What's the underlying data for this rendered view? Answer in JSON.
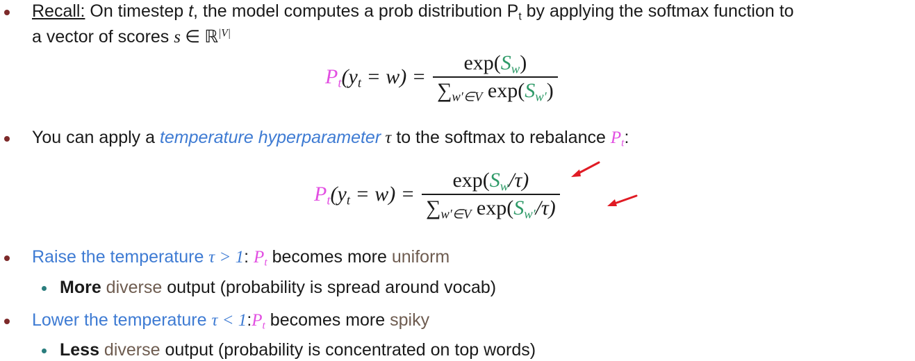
{
  "bullets": {
    "recall": {
      "label": "Recall:",
      "text_a": " On timestep ",
      "t": "t",
      "text_b": ", the model computes a prob distribution P",
      "P_sub": "t",
      "text_c": " by applying the softmax function to",
      "line2_a": "a vector of scores  ",
      "s": "s",
      "in": " ∈ ℝ",
      "sup": "|V|"
    },
    "temperature": {
      "text_a": "You can apply a ",
      "highlight": "temperature hyperparameter",
      "tau": " τ",
      "text_b": " to the softmax to rebalance ",
      "P": "P",
      "P_sub": "t",
      "colon": ":"
    },
    "raise": {
      "text_a": "Raise the temperature ",
      "cond": "τ > 1",
      "colon": ": ",
      "P": "P",
      "P_sub": "t",
      "text_b": " becomes more ",
      "word": "uniform",
      "sub_bold": "More",
      "sub_colored": " diverse",
      "sub_rest": " output (probability is spread around vocab)"
    },
    "lower": {
      "text_a": "Lower the temperature ",
      "cond": "τ < 1",
      "colon": ":",
      "P": "P",
      "P_sub": "t",
      "text_b": " becomes more ",
      "word": "spiky",
      "sub_bold": "Less",
      "sub_colored": " diverse",
      "sub_rest": " output (probability is concentrated on top words)"
    }
  },
  "formula1": {
    "P": "P",
    "P_sub": "t",
    "lhs_rest": "(y",
    "y_sub": "t",
    "eq": " =  w) =",
    "num_a": "exp(",
    "num_s": "S",
    "num_s_sub": "w",
    "num_b": ")",
    "den_sigma": "∑",
    "den_sigma_sub": "w′∈V",
    "den_a": " exp(",
    "den_s": "S",
    "den_s_sub": "w′",
    "den_b": ")"
  },
  "formula2": {
    "P": "P",
    "P_sub": "t",
    "lhs_rest": "(y",
    "y_sub": "t",
    "eq": " =  w) =",
    "num_a": "exp(",
    "num_s": "S",
    "num_s_sub": "w",
    "num_b": "/τ)",
    "den_sigma": "∑",
    "den_sigma_sub": "w′∈V",
    "den_a": " exp(",
    "den_s": "S",
    "den_s_sub": "w′",
    "den_b": "/τ)"
  },
  "colors": {
    "bullet": "#7d2a2a",
    "sub_bullet": "#2a7d7d",
    "blue": "#3e7bd3",
    "magenta": "#e24fe2",
    "green": "#2e9a68",
    "arrow": "#e01b24"
  }
}
